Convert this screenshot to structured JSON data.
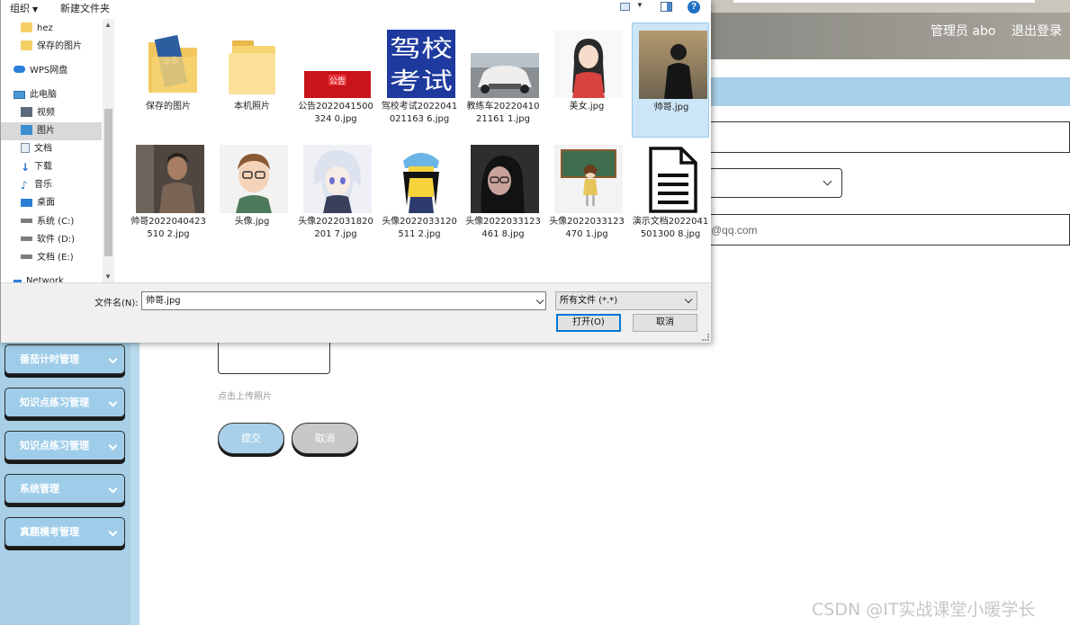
{
  "header": {
    "user": "管理员 abo",
    "logout": "退出登录"
  },
  "sidebar": {
    "items": [
      {
        "label": "番茄计时管理"
      },
      {
        "label": "知识点练习管理"
      },
      {
        "label": "知识点练习管理"
      },
      {
        "label": "系统管理"
      },
      {
        "label": "真题模考管理"
      }
    ]
  },
  "form": {
    "email_fragment": "@qq.com",
    "upload_hint": "点击上传照片",
    "submit_label": "提交",
    "cancel_label": "取消"
  },
  "watermark": "CSDN @IT实战课堂小暖学长",
  "dialog": {
    "toolbar": {
      "organize": "组织",
      "new_folder": "新建文件夹",
      "help": "?"
    },
    "nav_items": [
      {
        "label": "hez",
        "icon": "folder-icon"
      },
      {
        "label": "保存的图片",
        "icon": "folder-icon"
      },
      {
        "label": "WPS网盘",
        "icon": "cloud-icon"
      },
      {
        "label": "此电脑",
        "icon": "computer-icon"
      },
      {
        "label": "视频",
        "icon": "video-icon"
      },
      {
        "label": "图片",
        "icon": "pictures-icon",
        "selected": true
      },
      {
        "label": "文档",
        "icon": "document-icon"
      },
      {
        "label": "下载",
        "icon": "download-icon"
      },
      {
        "label": "音乐",
        "icon": "music-icon"
      },
      {
        "label": "桌面",
        "icon": "desktop-icon"
      },
      {
        "label": "系统 (C:)",
        "icon": "drive-icon"
      },
      {
        "label": "软件 (D:)",
        "icon": "drive-icon"
      },
      {
        "label": "文档 (E:)",
        "icon": "drive-icon"
      },
      {
        "label": "Network",
        "icon": "network-icon"
      }
    ],
    "files": [
      {
        "name": "保存的图片",
        "kind": "folder-special"
      },
      {
        "name": "本机照片",
        "kind": "folder"
      },
      {
        "name": "公告2022041500324 0.jpg",
        "kind": "img-notice",
        "thumb_text": "公告"
      },
      {
        "name": "驾校考试2022041021163 6.jpg",
        "kind": "img-exam",
        "thumb_text": "驾校考试"
      },
      {
        "name": "教练车2022041021161 1.jpg",
        "kind": "img-car"
      },
      {
        "name": "美女.jpg",
        "kind": "img-girl"
      },
      {
        "name": "帅哥.jpg",
        "kind": "img-guy",
        "selected": true
      },
      {
        "name": "帅哥2022040423510 2.jpg",
        "kind": "img-guy2"
      },
      {
        "name": "头像.jpg",
        "kind": "img-avatar-cartoon"
      },
      {
        "name": "头像2022031820201 7.jpg",
        "kind": "img-anime"
      },
      {
        "name": "头像2022033120511 2.jpg",
        "kind": "img-simpson"
      },
      {
        "name": "头像2022033123461 8.jpg",
        "kind": "img-girl2"
      },
      {
        "name": "头像2022033123470 1.jpg",
        "kind": "img-teacher"
      },
      {
        "name": "演示文档2022041501300 8.jpg",
        "kind": "img-document"
      }
    ],
    "filename_label": "文件名(N):",
    "filename_value": "帅哥.jpg",
    "filetype_value": "所有文件 (*.*)",
    "open_label": "打开(O)",
    "cancel_label": "取消"
  },
  "colors": {
    "sidebar_bg": "#a8cfe6",
    "menu_btn": "#9fcde9",
    "selection": "#cce6f7",
    "primary_button_border": "#0078d7"
  }
}
